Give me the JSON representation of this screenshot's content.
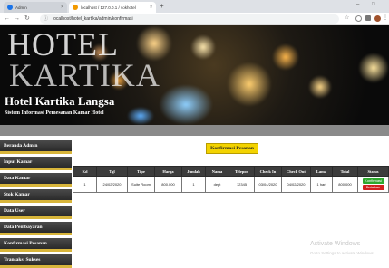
{
  "browser": {
    "tabs": [
      {
        "label": "Admin",
        "favicon_color": "#1a73e8"
      },
      {
        "label": "localhost / 127.0.0.1 / sokhotel",
        "favicon_color": "#f29900"
      }
    ],
    "new_tab_glyph": "+",
    "url": "localhost/hotel_kartika/admin/konfirmasi",
    "window_controls": [
      "–",
      "□"
    ]
  },
  "header": {
    "logo_word_1": "HOTEL",
    "logo_word_2": "KARTIKA",
    "title": "Hotel Kartika Langsa",
    "subtitle": "Sistem Informasi Pemesanan Kamar Hotel"
  },
  "sidebar": {
    "items": [
      {
        "label": "Beranda Admin"
      },
      {
        "label": "Input Kamar"
      },
      {
        "label": "Data Kamar"
      },
      {
        "label": "Stok Kamar"
      },
      {
        "label": "Data User"
      },
      {
        "label": "Data Pembayaran"
      },
      {
        "label": "Konfirmasi Pesanan"
      },
      {
        "label": "Transaksi Sukses"
      }
    ]
  },
  "main": {
    "confirm_button": "Konfirmasi Pesanan",
    "table": {
      "headers": [
        "Kd",
        "Tgl",
        "Tipe",
        "Harga",
        "Jumlah",
        "Nama",
        "Telepon",
        "Check In",
        "Check Out",
        "Lama",
        "Total",
        "Status"
      ],
      "rows": [
        {
          "cells": [
            "1",
            "24/02/2020",
            "Suite Room",
            "800.000",
            "1",
            "dept",
            "12345",
            "03/04/2020",
            "04/02/2020",
            "1 hari",
            "800.000"
          ],
          "status_buttons": [
            "Konfirmasi",
            "Batalkan"
          ]
        }
      ]
    }
  },
  "watermark": {
    "line1": "Activate Windows",
    "line2": "Go to Settings to activate Windows."
  },
  "colors": {
    "accent_yellow": "#f3d300",
    "sidebar_dark": "#333333",
    "sidebar_border": "#d8b53b",
    "status_green": "#2fa82f",
    "status_red": "#d32020"
  }
}
